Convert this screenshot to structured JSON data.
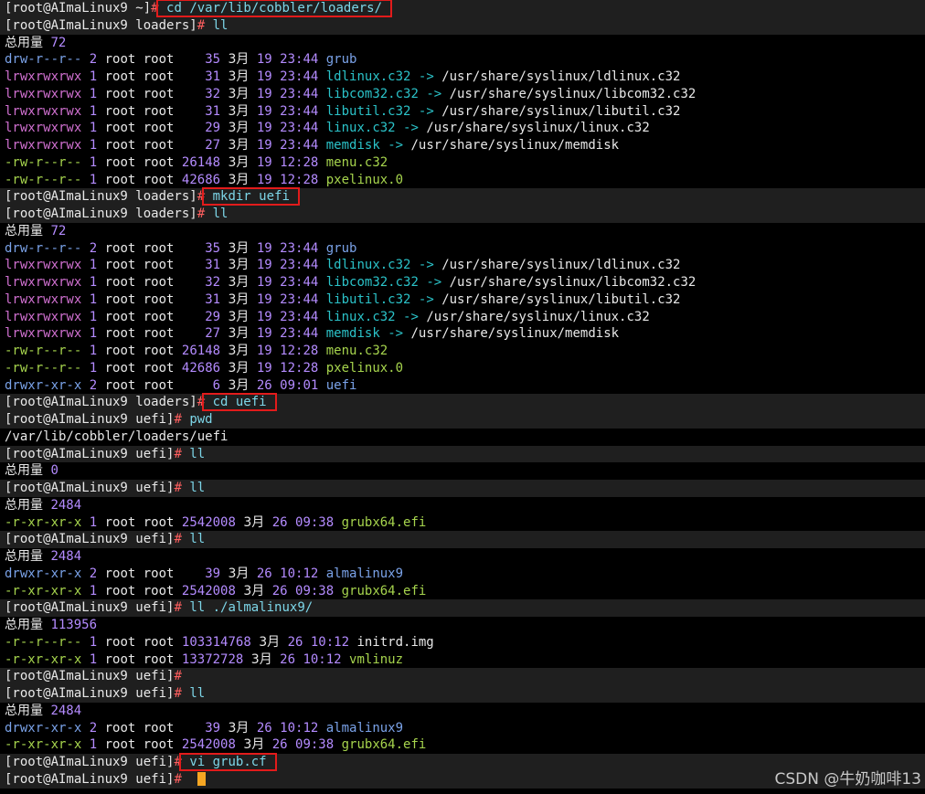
{
  "prompt_home": "[root@AImaLinux9 ~]",
  "prompt_loaders": "[root@AImaLinux9 loaders]",
  "prompt_uefi": "[root@AImaLinux9 uefi]",
  "hash": "#",
  "total_label": "总用量",
  "watermark": "CSDN @牛奶咖啡13",
  "colors": {
    "background": "#000000",
    "prompt_bg": "#1f1f1f",
    "highlight": "#e21b1b",
    "cursor": "#f5a623"
  },
  "lines": [
    {
      "type": "prompt",
      "prompt": "[root@AImaLinux9 ~]",
      "cmd": "cd /var/lib/cobbler/loaders/",
      "highlight": true
    },
    {
      "type": "prompt",
      "prompt": "[root@AImaLinux9 loaders]",
      "cmd": "ll"
    },
    {
      "type": "total",
      "value": "72"
    },
    {
      "type": "entry",
      "perm": "drw-r--r--",
      "kind": "dir",
      "links": "2",
      "owner": "root root",
      "size": "35",
      "month": "3月",
      "day": "19",
      "time": "23:44",
      "name": "grub"
    },
    {
      "type": "entry",
      "perm": "lrwxrwxrwx",
      "kind": "link",
      "links": "1",
      "owner": "root root",
      "size": "31",
      "month": "3月",
      "day": "19",
      "time": "23:44",
      "name": "ldlinux.c32",
      "target": "/usr/share/syslinux/ldlinux.c32"
    },
    {
      "type": "entry",
      "perm": "lrwxrwxrwx",
      "kind": "link",
      "links": "1",
      "owner": "root root",
      "size": "32",
      "month": "3月",
      "day": "19",
      "time": "23:44",
      "name": "libcom32.c32",
      "target": "/usr/share/syslinux/libcom32.c32"
    },
    {
      "type": "entry",
      "perm": "lrwxrwxrwx",
      "kind": "link",
      "links": "1",
      "owner": "root root",
      "size": "31",
      "month": "3月",
      "day": "19",
      "time": "23:44",
      "name": "libutil.c32",
      "target": "/usr/share/syslinux/libutil.c32"
    },
    {
      "type": "entry",
      "perm": "lrwxrwxrwx",
      "kind": "link",
      "links": "1",
      "owner": "root root",
      "size": "29",
      "month": "3月",
      "day": "19",
      "time": "23:44",
      "name": "linux.c32",
      "target": "/usr/share/syslinux/linux.c32"
    },
    {
      "type": "entry",
      "perm": "lrwxrwxrwx",
      "kind": "link",
      "links": "1",
      "owner": "root root",
      "size": "27",
      "month": "3月",
      "day": "19",
      "time": "23:44",
      "name": "memdisk",
      "target": "/usr/share/syslinux/memdisk"
    },
    {
      "type": "entry",
      "perm": "-rw-r--r--",
      "kind": "file",
      "links": "1",
      "owner": "root root",
      "size": "26148",
      "month": "3月",
      "day": "19",
      "time": "12:28",
      "name": "menu.c32"
    },
    {
      "type": "entry",
      "perm": "-rw-r--r--",
      "kind": "file",
      "links": "1",
      "owner": "root root",
      "size": "42686",
      "month": "3月",
      "day": "19",
      "time": "12:28",
      "name": "pxelinux.0"
    },
    {
      "type": "prompt",
      "prompt": "[root@AImaLinux9 loaders]",
      "cmd": "mkdir uefi",
      "highlight": true
    },
    {
      "type": "prompt",
      "prompt": "[root@AImaLinux9 loaders]",
      "cmd": "ll"
    },
    {
      "type": "total",
      "value": "72"
    },
    {
      "type": "entry",
      "perm": "drw-r--r--",
      "kind": "dir",
      "links": "2",
      "owner": "root root",
      "size": "35",
      "month": "3月",
      "day": "19",
      "time": "23:44",
      "name": "grub"
    },
    {
      "type": "entry",
      "perm": "lrwxrwxrwx",
      "kind": "link",
      "links": "1",
      "owner": "root root",
      "size": "31",
      "month": "3月",
      "day": "19",
      "time": "23:44",
      "name": "ldlinux.c32",
      "target": "/usr/share/syslinux/ldlinux.c32"
    },
    {
      "type": "entry",
      "perm": "lrwxrwxrwx",
      "kind": "link",
      "links": "1",
      "owner": "root root",
      "size": "32",
      "month": "3月",
      "day": "19",
      "time": "23:44",
      "name": "libcom32.c32",
      "target": "/usr/share/syslinux/libcom32.c32"
    },
    {
      "type": "entry",
      "perm": "lrwxrwxrwx",
      "kind": "link",
      "links": "1",
      "owner": "root root",
      "size": "31",
      "month": "3月",
      "day": "19",
      "time": "23:44",
      "name": "libutil.c32",
      "target": "/usr/share/syslinux/libutil.c32"
    },
    {
      "type": "entry",
      "perm": "lrwxrwxrwx",
      "kind": "link",
      "links": "1",
      "owner": "root root",
      "size": "29",
      "month": "3月",
      "day": "19",
      "time": "23:44",
      "name": "linux.c32",
      "target": "/usr/share/syslinux/linux.c32"
    },
    {
      "type": "entry",
      "perm": "lrwxrwxrwx",
      "kind": "link",
      "links": "1",
      "owner": "root root",
      "size": "27",
      "month": "3月",
      "day": "19",
      "time": "23:44",
      "name": "memdisk",
      "target": "/usr/share/syslinux/memdisk"
    },
    {
      "type": "entry",
      "perm": "-rw-r--r--",
      "kind": "file",
      "links": "1",
      "owner": "root root",
      "size": "26148",
      "month": "3月",
      "day": "19",
      "time": "12:28",
      "name": "menu.c32"
    },
    {
      "type": "entry",
      "perm": "-rw-r--r--",
      "kind": "file",
      "links": "1",
      "owner": "root root",
      "size": "42686",
      "month": "3月",
      "day": "19",
      "time": "12:28",
      "name": "pxelinux.0"
    },
    {
      "type": "entry",
      "perm": "drwxr-xr-x",
      "kind": "dir",
      "links": "2",
      "owner": "root root",
      "size": "6",
      "month": "3月",
      "day": "26",
      "time": "09:01",
      "name": "uefi"
    },
    {
      "type": "prompt",
      "prompt": "[root@AImaLinux9 loaders]",
      "cmd": "cd uefi",
      "highlight": true
    },
    {
      "type": "prompt",
      "prompt": "[root@AImaLinux9 uefi]",
      "cmd": "pwd"
    },
    {
      "type": "text",
      "text": "/var/lib/cobbler/loaders/uefi"
    },
    {
      "type": "prompt",
      "prompt": "[root@AImaLinux9 uefi]",
      "cmd": "ll"
    },
    {
      "type": "total",
      "value": "0"
    },
    {
      "type": "prompt",
      "prompt": "[root@AImaLinux9 uefi]",
      "cmd": "ll"
    },
    {
      "type": "total",
      "value": "2484"
    },
    {
      "type": "entry",
      "perm": "-r-xr-xr-x",
      "kind": "file",
      "links": "1",
      "owner": "root root",
      "size": "2542008",
      "month": "3月",
      "day": "26",
      "time": "09:38",
      "name": "grubx64.efi"
    },
    {
      "type": "prompt",
      "prompt": "[root@AImaLinux9 uefi]",
      "cmd": "ll"
    },
    {
      "type": "total",
      "value": "2484"
    },
    {
      "type": "entry",
      "perm": "drwxr-xr-x",
      "kind": "dir",
      "links": "2",
      "owner": "root root",
      "size": "39",
      "month": "3月",
      "day": "26",
      "time": "10:12",
      "name": "almalinux9"
    },
    {
      "type": "entry",
      "perm": "-r-xr-xr-x",
      "kind": "file",
      "links": "1",
      "owner": "root root",
      "size": "2542008",
      "month": "3月",
      "day": "26",
      "time": "09:38",
      "name": "grubx64.efi"
    },
    {
      "type": "prompt",
      "prompt": "[root@AImaLinux9 uefi]",
      "cmd": "ll ./almalinux9/"
    },
    {
      "type": "total",
      "value": "113956"
    },
    {
      "type": "entry",
      "perm": "-r--r--r--",
      "kind": "plain",
      "links": "1",
      "owner": "root root",
      "size": "103314768",
      "month": "3月",
      "day": "26",
      "time": "10:12",
      "name": "initrd.img"
    },
    {
      "type": "entry",
      "perm": "-r-xr-xr-x",
      "kind": "file",
      "links": "1",
      "owner": "root root",
      "size": "13372728",
      "month": "3月",
      "day": "26",
      "time": "10:12",
      "name": "vmlinuz"
    },
    {
      "type": "prompt",
      "prompt": "[root@AImaLinux9 uefi]",
      "cmd": ""
    },
    {
      "type": "prompt",
      "prompt": "[root@AImaLinux9 uefi]",
      "cmd": "ll"
    },
    {
      "type": "total",
      "value": "2484"
    },
    {
      "type": "entry",
      "perm": "drwxr-xr-x",
      "kind": "dir",
      "links": "2",
      "owner": "root root",
      "size": "39",
      "month": "3月",
      "day": "26",
      "time": "10:12",
      "name": "almalinux9"
    },
    {
      "type": "entry",
      "perm": "-r-xr-xr-x",
      "kind": "file",
      "links": "1",
      "owner": "root root",
      "size": "2542008",
      "month": "3月",
      "day": "26",
      "time": "09:38",
      "name": "grubx64.efi"
    },
    {
      "type": "prompt",
      "prompt": "[root@AImaLinux9 uefi]",
      "cmd": "vi grub.cf",
      "highlight": true
    },
    {
      "type": "prompt",
      "prompt": "[root@AImaLinux9 uefi]",
      "cmd": "",
      "cursor": true
    }
  ]
}
